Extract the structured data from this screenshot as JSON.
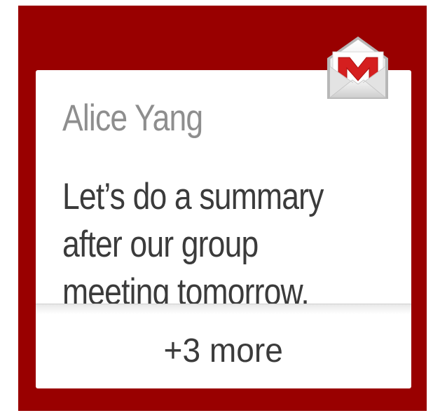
{
  "notification": {
    "app_icon": "gmail-envelope-icon",
    "sender": "Alice Yang",
    "message": "Let’s do a summary\nafter our group\nmeeting tomorrow.",
    "more_label": "+3 more"
  },
  "colors": {
    "watch_background": "#990000",
    "card_background": "#ffffff",
    "sender_text": "#8e8e8e",
    "message_text": "#3b3b3b",
    "gmail_red": "#d51f1f"
  }
}
